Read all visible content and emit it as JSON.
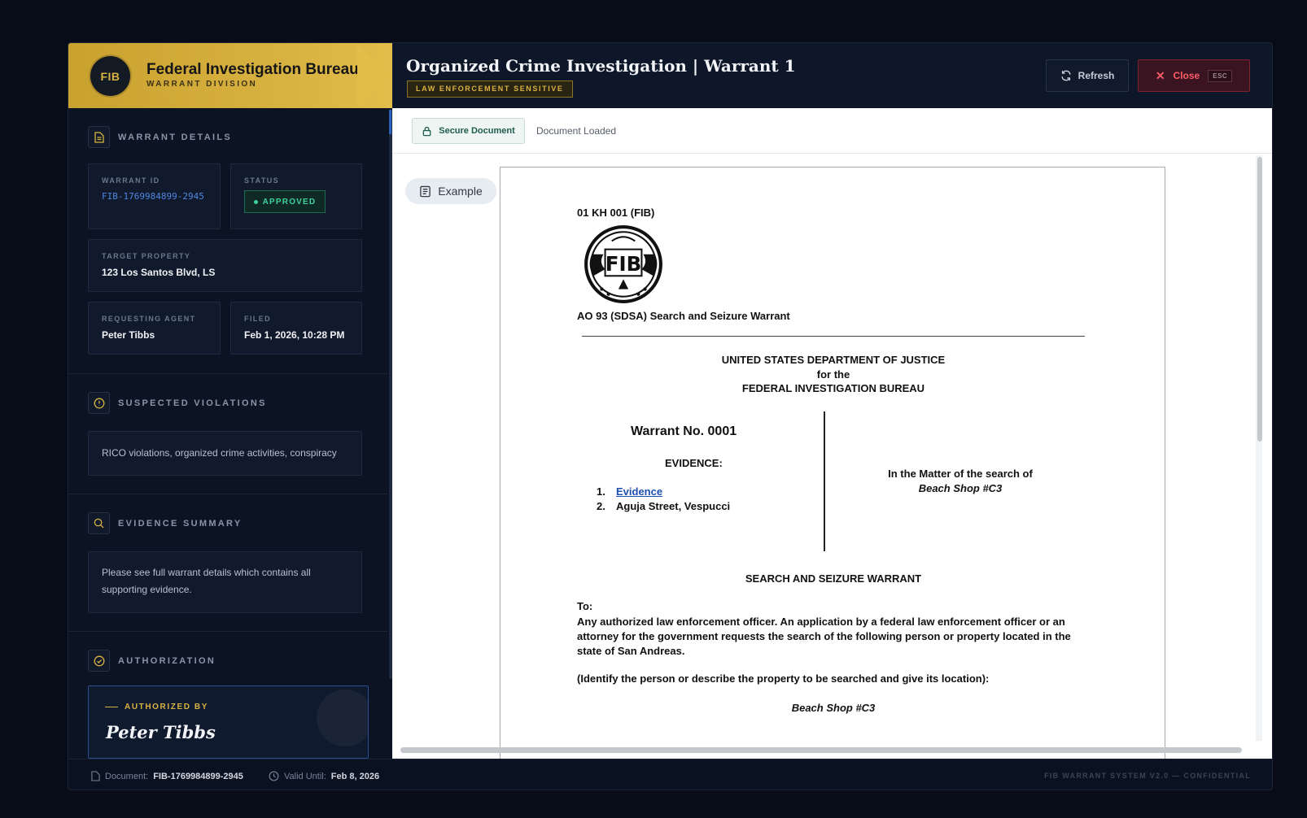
{
  "brand": {
    "badge": "FIB",
    "title": "Federal Investigation Bureau",
    "subtitle": "WARRANT DIVISION"
  },
  "header": {
    "title": "Organized Crime Investigation | Warrant 1",
    "badge": "LAW ENFORCEMENT SENSITIVE",
    "refresh_label": "Refresh",
    "close_label": "Close",
    "close_kbd": "ESC"
  },
  "sidebar": {
    "warrant_details": {
      "heading": "WARRANT DETAILS",
      "warrant_id_label": "WARRANT ID",
      "warrant_id_value": "FIB-1769984899-2945",
      "status_label": "STATUS",
      "status_value": "APPROVED",
      "target_label": "TARGET PROPERTY",
      "target_value": "123 Los Santos Blvd, LS",
      "agent_label": "REQUESTING AGENT",
      "agent_value": "Peter Tibbs",
      "filed_label": "FILED",
      "filed_value": "Feb 1, 2026, 10:28 PM"
    },
    "violations": {
      "heading": "SUSPECTED VIOLATIONS",
      "text": "RICO violations, organized crime activities, conspiracy"
    },
    "evidence": {
      "heading": "EVIDENCE SUMMARY",
      "text": "Please see full warrant details which contains all supporting evidence."
    },
    "authorization": {
      "heading": "AUTHORIZATION",
      "by_label": "AUTHORIZED BY",
      "name": "Peter Tibbs"
    }
  },
  "toolbar": {
    "secure_label": "Secure Document",
    "status_text": "Document Loaded",
    "example_label": "Example"
  },
  "document": {
    "code": "01 KH 001 (FIB)",
    "seal_text": "FIB",
    "form_title": "AO 93 (SDSA) Search and Seizure Warrant",
    "dept_line1": "UNITED STATES DEPARTMENT OF JUSTICE",
    "dept_line2": "for the",
    "dept_line3": "FEDERAL INVESTIGATION BUREAU",
    "warrant_no": "Warrant No. 0001",
    "evidence_heading": "EVIDENCE:",
    "evidence_items": [
      {
        "num": "1.",
        "text": "Evidence"
      },
      {
        "num": "2.",
        "text": "Aguja Street, Vespucci"
      }
    ],
    "matter_line1": "In the Matter of the search of",
    "matter_line2": "Beach Shop #C3",
    "section_title": "SEARCH AND SEIZURE WARRANT",
    "to_label": "To:",
    "to_text": "Any authorized law enforcement officer. An application by a federal law enforcement officer or an attorney for the government requests the search of the following person or property located in the state of San Andreas.",
    "identify_text": "(Identify the person or describe the property to be searched and give its location):",
    "property": "Beach Shop #C3"
  },
  "footer": {
    "document_label": "Document:",
    "document_value": "FIB-1769984899-2945",
    "valid_label": "Valid Until:",
    "valid_value": "Feb 8, 2026",
    "system_text": "FIB WARRANT SYSTEM V2.0 — CONFIDENTIAL"
  },
  "colors": {
    "gold": "#d9b342",
    "approved": "#3fd39a",
    "close_red": "#ff5a68",
    "link_blue": "#4f86e0"
  }
}
